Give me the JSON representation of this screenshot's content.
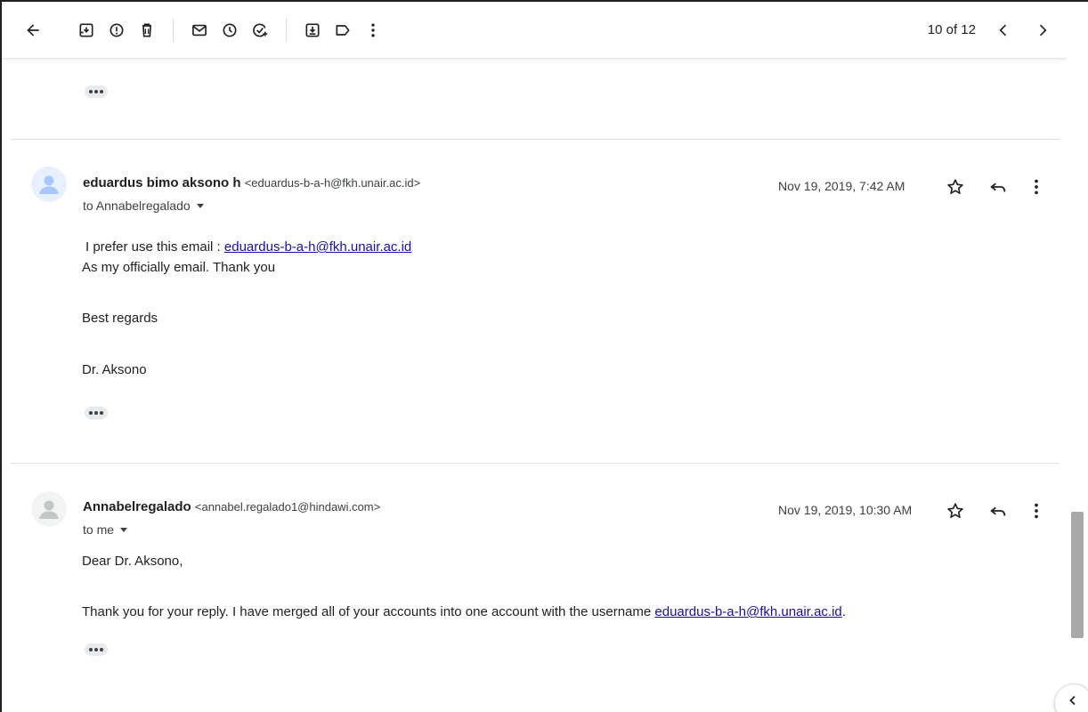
{
  "toolbar": {
    "icons": [
      "back-arrow-icon",
      "archive-icon",
      "report-spam-icon",
      "delete-icon",
      "mark-unread-icon",
      "snooze-icon",
      "add-task-icon",
      "move-to-icon",
      "label-icon",
      "more-vert-icon"
    ],
    "pager_text": "10 of 12"
  },
  "messages": [
    {
      "sender_name": "eduardus bimo aksono h",
      "sender_email": "<eduardus-b-a-h@fkh.unair.ac.id>",
      "to_text": "to Annabelregalado",
      "date": "Nov 19, 2019, 7:42 AM",
      "avatar_color": "#a8c7fa",
      "lines": {
        "l1_prefix": "I prefer use this email : ",
        "l1_link": "eduardus-b-a-h@fkh.unair.ac.id",
        "l2": "As my officially email. Thank you",
        "l3": "Best regards",
        "l4": "Dr. Aksono"
      }
    },
    {
      "sender_name": "Annabelregalado",
      "sender_email": "<annabel.regalado1@hindawi.com>",
      "to_text": "to me",
      "date": "Nov 19, 2019, 10:30 AM",
      "avatar_color": "#dadce0",
      "lines": {
        "l1": "Dear Dr. Aksono,",
        "l2_prefix": "Thank you for your reply. I have merged all of your accounts into one account with the username ",
        "l2_link": "eduardus-b-a-h@fkh.unair.ac.id",
        "l2_suffix": "."
      }
    }
  ],
  "colors": {
    "link": "#1a0dab",
    "scroll_thumb": "#a8a8a8"
  }
}
